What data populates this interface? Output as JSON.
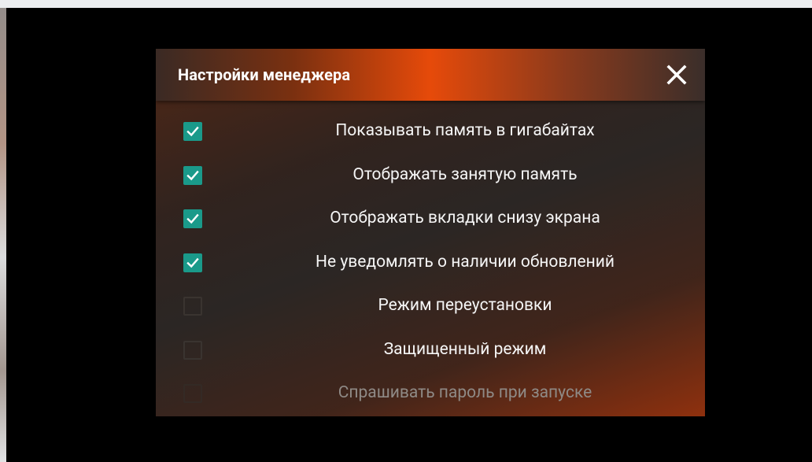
{
  "dialog": {
    "title": "Настройки менеджера",
    "close_icon": "close-icon"
  },
  "colors": {
    "checkbox_checked": "#1a9a8a",
    "header_accent": "#e64a0a",
    "dialog_background": "#2b2624",
    "text": "#f5f5f5",
    "text_disabled": "#8f8a86"
  },
  "options": [
    {
      "label": "Показывать память в гигабайтах",
      "checked": true,
      "enabled": true
    },
    {
      "label": "Отображать занятую память",
      "checked": true,
      "enabled": true
    },
    {
      "label": "Отображать вкладки снизу экрана",
      "checked": true,
      "enabled": true
    },
    {
      "label": "Не уведомлять о наличии обновлений",
      "checked": true,
      "enabled": true
    },
    {
      "label": "Режим переустановки",
      "checked": false,
      "enabled": true
    },
    {
      "label": "Защищенный режим",
      "checked": false,
      "enabled": true
    },
    {
      "label": "Спрашивать пароль при запуске",
      "checked": false,
      "enabled": false
    }
  ]
}
